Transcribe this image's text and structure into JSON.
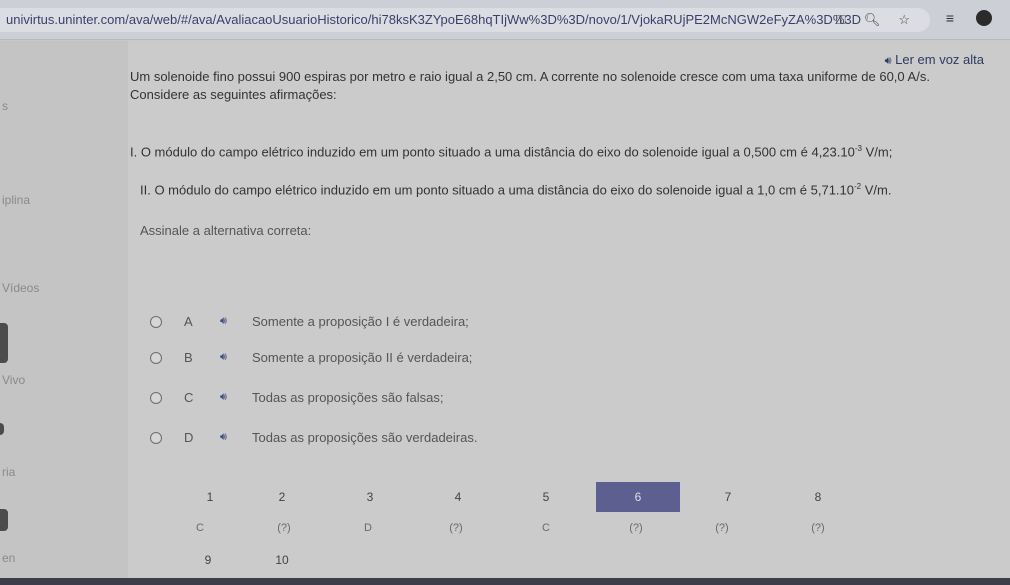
{
  "browser": {
    "url": "univirtus.uninter.com/ava/web/#/ava/AvaliacaoUsuarioHistorico/hi78ksK3ZYpoE68hqTIjWw%3D%3D/novo/1/VjokaRUjPE2McNGW2eFyZA%3D%3D"
  },
  "sidebar": {
    "items": [
      "s",
      "iplina",
      "Vídeos",
      "Vivo",
      "ria",
      "en"
    ]
  },
  "listen_label": "Ler em voz alta",
  "question": {
    "statement": "Um solenoide fino possui 900 espiras por metro e raio igual a 2,50 cm. A corrente no solenoide cresce com uma taxa uniforme de 60,0 A/s.",
    "intro": "Considere as seguintes afirmações:",
    "prop1_text": "I. O módulo do campo elétrico induzido em um ponto situado a uma distância do eixo do solenoide igual a 0,500 cm é 4,23.10",
    "prop1_exp": "-3",
    "prop1_unit": " V/m;",
    "prop2_text": "II. O módulo do campo elétrico induzido em um ponto situado a uma distância do eixo do solenoide igual a 1,0 cm é 5,71.10",
    "prop2_exp": "-2",
    "prop2_unit": " V/m.",
    "instruction": "Assinale a alternativa correta:"
  },
  "options": [
    {
      "letter": "A",
      "text": "Somente a proposição I é verdadeira;"
    },
    {
      "letter": "B",
      "text": "Somente a proposição II é verdadeira;"
    },
    {
      "letter": "C",
      "text": "Todas as proposições são falsas;"
    },
    {
      "letter": "D",
      "text": "Todas as proposições são verdadeiras."
    }
  ],
  "navigation": {
    "row1": [
      {
        "num": "1",
        "answer": "C"
      },
      {
        "num": "2",
        "answer": "(?)"
      },
      {
        "num": "3",
        "answer": "D"
      },
      {
        "num": "4",
        "answer": "(?)"
      },
      {
        "num": "5",
        "answer": "C"
      },
      {
        "num": "6",
        "answer": "(?)"
      },
      {
        "num": "7",
        "answer": "(?)"
      },
      {
        "num": "8",
        "answer": "(?)"
      }
    ],
    "row2": [
      {
        "num": "9"
      },
      {
        "num": "10"
      }
    ],
    "current": "6"
  },
  "colors": {
    "accent": "#5c5f8f",
    "speaker": "#3c4b80"
  },
  "icons": [
    "key-icon",
    "zoom-icon",
    "star-icon",
    "reading-list-icon",
    "extension-icon",
    "speaker-icon"
  ]
}
